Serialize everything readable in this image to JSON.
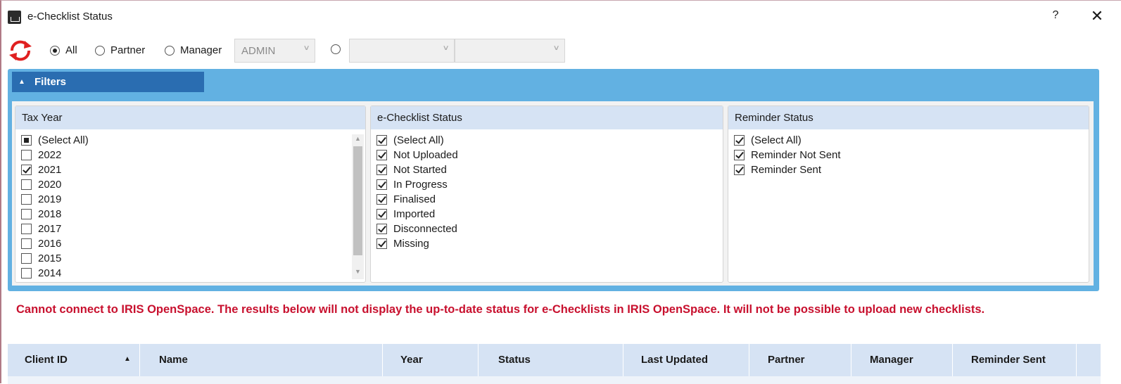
{
  "window": {
    "title": "e-Checklist Status",
    "help_label": "?",
    "close_label": "✕"
  },
  "toolbar": {
    "radios": [
      {
        "label": "All",
        "selected": true
      },
      {
        "label": "Partner",
        "selected": false
      },
      {
        "label": "Manager",
        "selected": false
      },
      {
        "label": "",
        "selected": false
      }
    ],
    "manager_combo": {
      "value": "ADMIN"
    },
    "combo2": {
      "value": ""
    },
    "combo3": {
      "value": ""
    }
  },
  "filters": {
    "header_label": "Filters",
    "tax_year": {
      "title": "Tax Year",
      "items": [
        {
          "label": "(Select All)",
          "state": "partial"
        },
        {
          "label": "2022",
          "state": "unchecked"
        },
        {
          "label": "2021",
          "state": "checked"
        },
        {
          "label": "2020",
          "state": "unchecked"
        },
        {
          "label": "2019",
          "state": "unchecked"
        },
        {
          "label": "2018",
          "state": "unchecked"
        },
        {
          "label": "2017",
          "state": "unchecked"
        },
        {
          "label": "2016",
          "state": "unchecked"
        },
        {
          "label": "2015",
          "state": "unchecked"
        },
        {
          "label": "2014",
          "state": "unchecked"
        }
      ]
    },
    "echecklist_status": {
      "title": "e-Checklist Status",
      "items": [
        {
          "label": "(Select All)",
          "state": "checked"
        },
        {
          "label": "Not Uploaded",
          "state": "checked"
        },
        {
          "label": "Not Started",
          "state": "checked"
        },
        {
          "label": "In Progress",
          "state": "checked"
        },
        {
          "label": "Finalised",
          "state": "checked"
        },
        {
          "label": "Imported",
          "state": "checked"
        },
        {
          "label": "Disconnected",
          "state": "checked"
        },
        {
          "label": "Missing",
          "state": "checked"
        }
      ]
    },
    "reminder_status": {
      "title": "Reminder Status",
      "items": [
        {
          "label": "(Select All)",
          "state": "checked"
        },
        {
          "label": "Reminder Not Sent",
          "state": "checked"
        },
        {
          "label": "Reminder Sent",
          "state": "checked"
        }
      ]
    }
  },
  "error_message": "Cannot connect to IRIS OpenSpace. The results below will not display the up-to-date status for e-Checklists in IRIS OpenSpace. It will not be possible to upload new checklists.",
  "grid": {
    "columns": [
      {
        "label": "Client ID",
        "sorted": "asc"
      },
      {
        "label": "Name"
      },
      {
        "label": "Year"
      },
      {
        "label": "Status"
      },
      {
        "label": "Last Updated"
      },
      {
        "label": "Partner"
      },
      {
        "label": "Manager"
      },
      {
        "label": "Reminder Sent"
      }
    ]
  },
  "colors": {
    "accent_blue": "#62b1e2",
    "filters_header": "#2a6db1",
    "header_bg": "#d6e3f4",
    "error_red": "#c8102e",
    "refresh_red": "#e02020"
  }
}
